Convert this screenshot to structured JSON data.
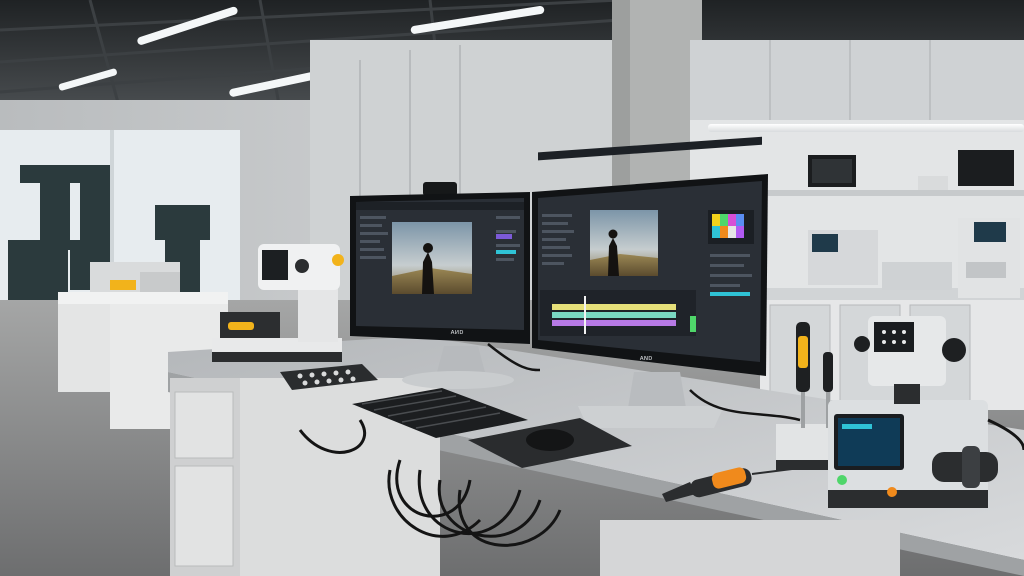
{
  "scene": {
    "left_monitor_badge": "ᴀᴎᴅ",
    "right_monitor_badge": "ᴀɴᴅ"
  },
  "colors": {
    "ceiling": "#2b2e30",
    "back_wall": "#c9cbcc",
    "window_glow": "#e9eef1",
    "floor": "#8e8f8f",
    "desk_top": "#c3c5c7",
    "desk_front": "#dcdddd",
    "monitor_bezel": "#111315",
    "editor_bg": "#2a2f36",
    "accent_teal": "#2fc3d6",
    "accent_yellow": "#f2b31b",
    "accent_orange": "#f08a1c"
  },
  "icons": [
    "keyboard-icon",
    "mouse-icon",
    "webcam-icon",
    "screwdriver-icon",
    "soldering-iron-icon",
    "microscope-icon"
  ]
}
